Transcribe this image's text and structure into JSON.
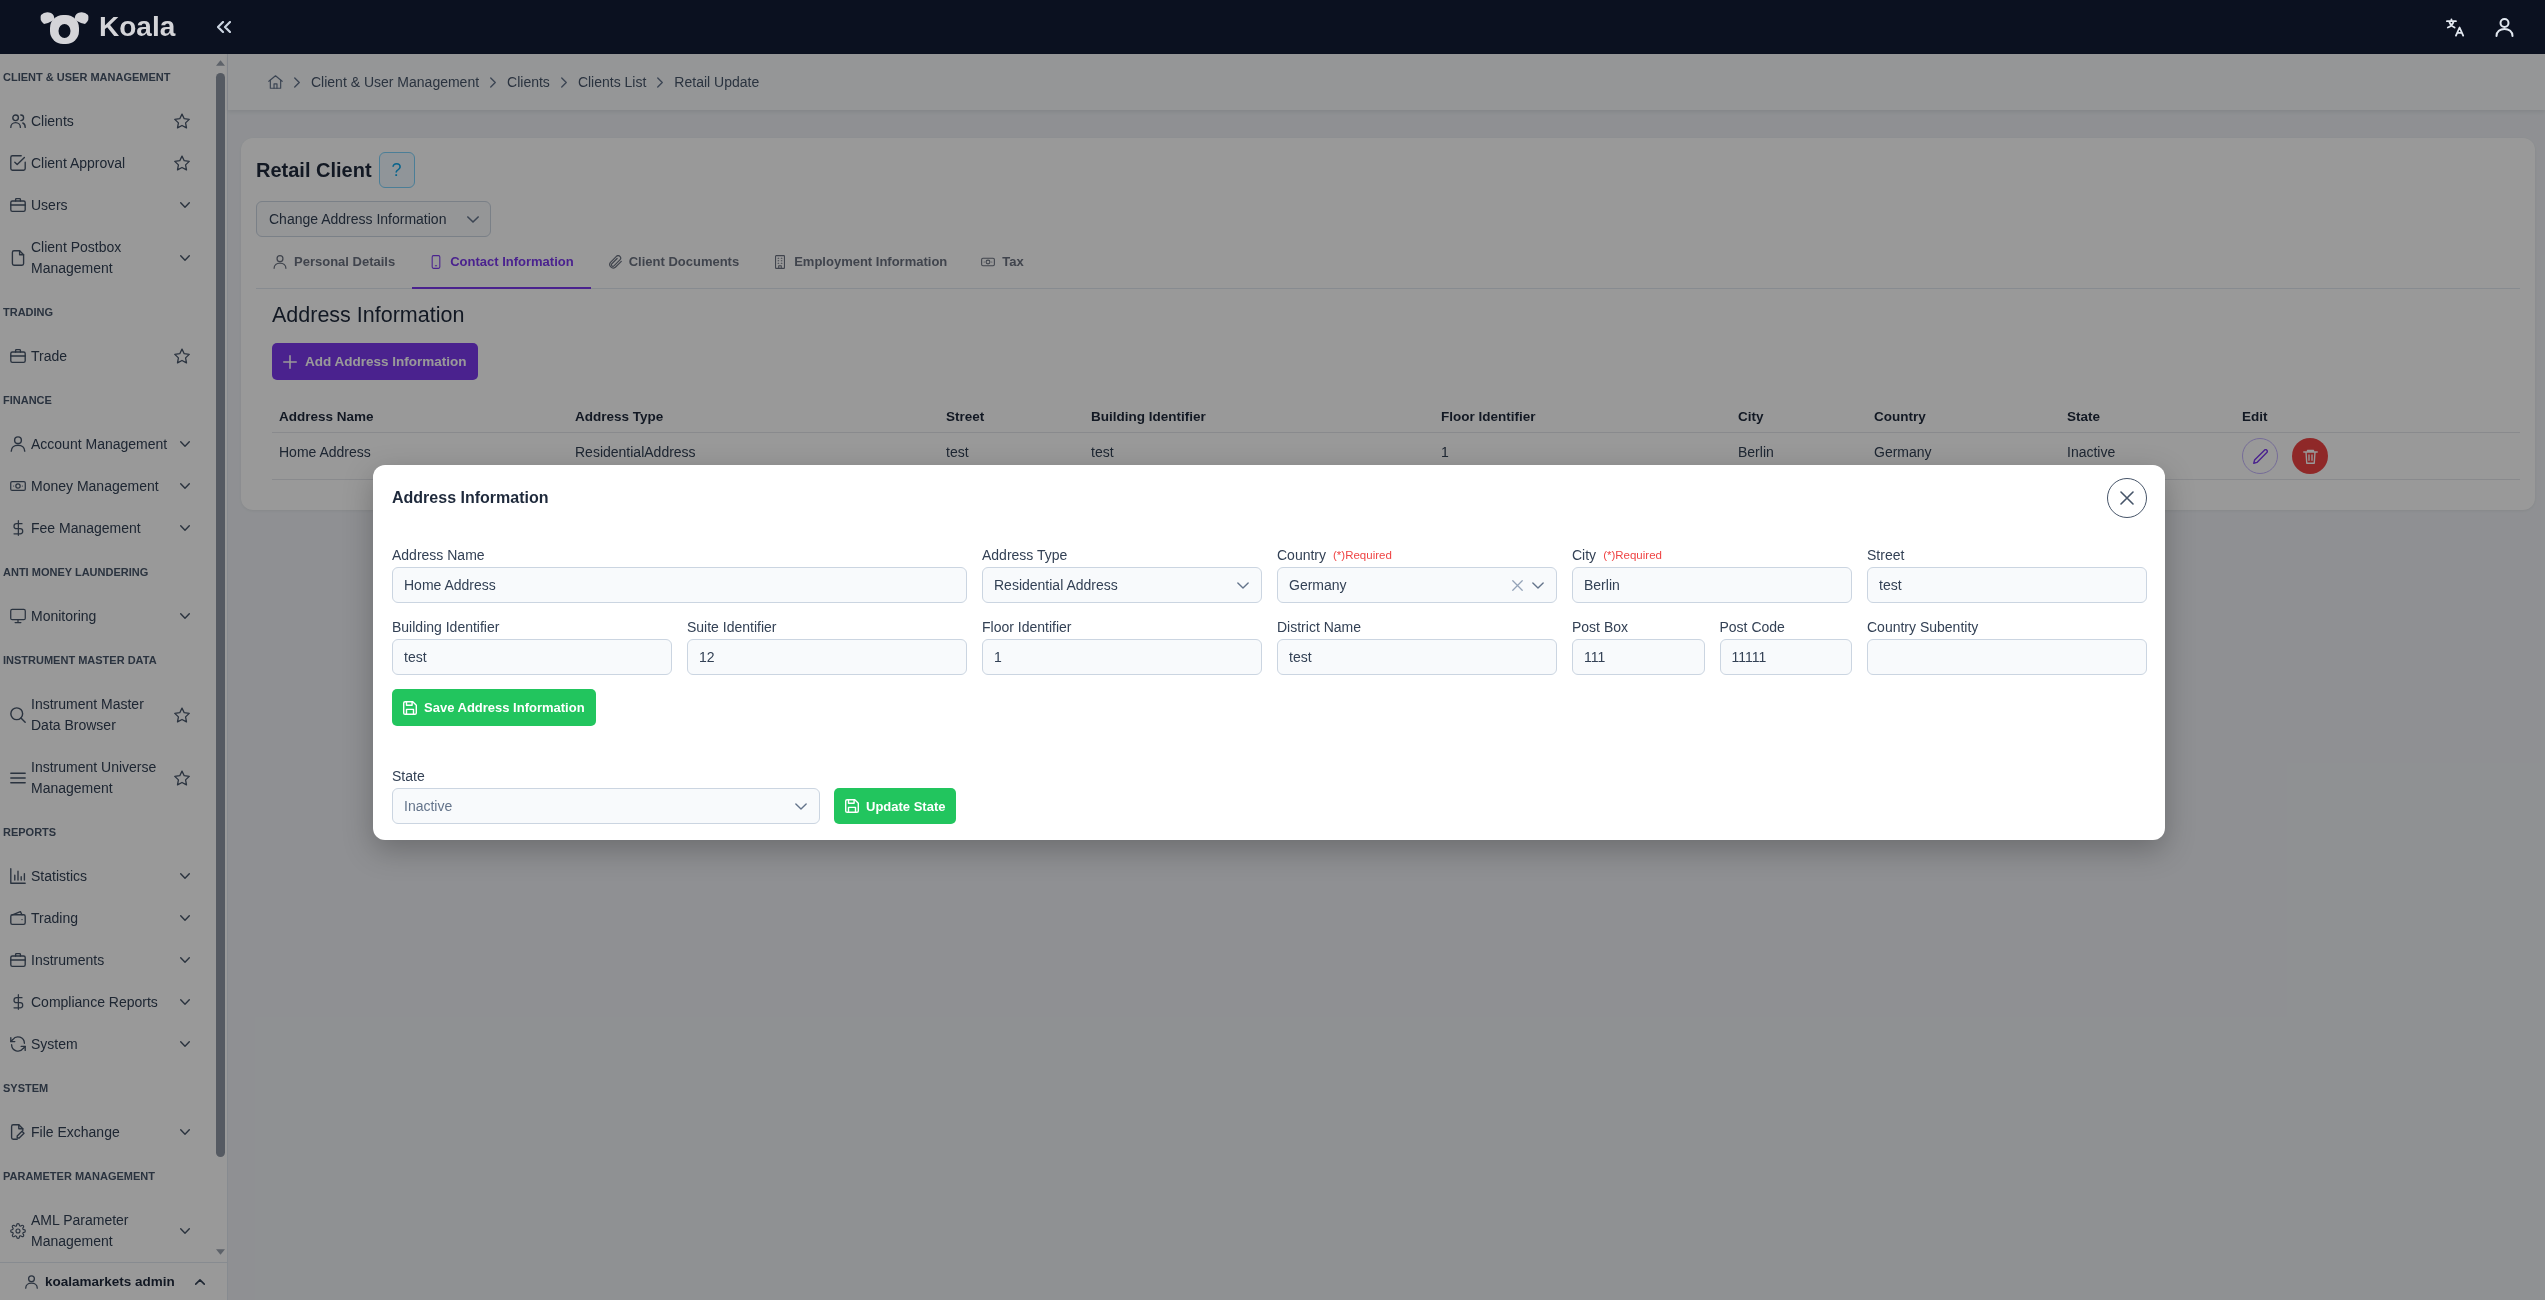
{
  "topbar": {
    "logo_text": "Koala"
  },
  "sidebar": {
    "sections": [
      {
        "title": "CLIENT & USER MANAGEMENT",
        "items": [
          {
            "label": "Clients",
            "kind": "favorite"
          },
          {
            "label": "Client Approval",
            "kind": "favorite"
          },
          {
            "label": "Users",
            "kind": "expandable"
          },
          {
            "label": "Client Postbox Management",
            "kind": "expandable"
          }
        ]
      },
      {
        "title": "TRADING",
        "items": [
          {
            "label": "Trade",
            "kind": "favorite"
          }
        ]
      },
      {
        "title": "FINANCE",
        "items": [
          {
            "label": "Account Management",
            "kind": "expandable"
          },
          {
            "label": "Money Management",
            "kind": "expandable"
          },
          {
            "label": "Fee Management",
            "kind": "expandable"
          }
        ]
      },
      {
        "title": "ANTI MONEY LAUNDERING",
        "items": [
          {
            "label": "Monitoring",
            "kind": "expandable"
          }
        ]
      },
      {
        "title": "INSTRUMENT MASTER DATA",
        "items": [
          {
            "label": "Instrument Master Data Browser",
            "kind": "favorite"
          },
          {
            "label": "Instrument Universe Management",
            "kind": "favorite"
          }
        ]
      },
      {
        "title": "REPORTS",
        "items": [
          {
            "label": "Statistics",
            "kind": "expandable"
          },
          {
            "label": "Trading",
            "kind": "expandable"
          },
          {
            "label": "Instruments",
            "kind": "expandable"
          },
          {
            "label": "Compliance Reports",
            "kind": "expandable"
          },
          {
            "label": "System",
            "kind": "expandable"
          }
        ]
      },
      {
        "title": "SYSTEM",
        "items": [
          {
            "label": "File Exchange",
            "kind": "expandable"
          }
        ]
      },
      {
        "title": "PARAMETER MANAGEMENT",
        "items": [
          {
            "label": "AML Parameter Management",
            "kind": "expandable"
          }
        ]
      }
    ],
    "user_name": "koalamarkets admin"
  },
  "breadcrumb": [
    "Client & User Management",
    "Clients",
    "Clients List",
    "Retail Update"
  ],
  "page": {
    "title": "Retail Client",
    "help_button": "?",
    "action_select": "Change Address Information",
    "tabs": [
      {
        "label": "Personal Details",
        "selected": false
      },
      {
        "label": "Contact Information",
        "selected": true
      },
      {
        "label": "Client Documents",
        "selected": false
      },
      {
        "label": "Employment Information",
        "selected": false
      },
      {
        "label": "Tax",
        "selected": false
      }
    ],
    "section_title": "Address Information",
    "add_button": "Add Address Information",
    "table": {
      "columns": [
        "Address Name",
        "Address Type",
        "Street",
        "Building Identifier",
        "Floor Identifier",
        "City",
        "Country",
        "State",
        "Edit"
      ],
      "rows": [
        {
          "cells": [
            "Home Address",
            "ResidentialAddress",
            "test",
            "test",
            "1",
            "Berlin",
            "Germany",
            "Inactive"
          ]
        }
      ]
    }
  },
  "modal": {
    "title": "Address Information",
    "fields": [
      {
        "label": "Address Name",
        "kind": "text",
        "value": "Home Address"
      },
      {
        "label": "Address Type",
        "kind": "select",
        "value": "Residential Address"
      },
      {
        "label": "Country",
        "required_note": "(*)Required",
        "kind": "clearable-select",
        "value": "Germany"
      },
      {
        "label": "City",
        "required_note": "(*)Required",
        "kind": "text",
        "value": "Berlin"
      },
      {
        "label": "Street",
        "kind": "text",
        "value": "test"
      },
      {
        "label": "Building Identifier",
        "kind": "text",
        "value": "test"
      },
      {
        "label": "Suite Identifier",
        "kind": "text",
        "value": "12"
      },
      {
        "label": "Floor Identifier",
        "kind": "text",
        "value": "1"
      },
      {
        "label": "District Name",
        "kind": "text",
        "value": "test"
      },
      {
        "label": "Post Box",
        "kind": "text",
        "value": "111"
      },
      {
        "label": "Post Code",
        "kind": "text",
        "value": "11111"
      },
      {
        "label": "Country Subentity",
        "kind": "text"
      }
    ],
    "save_button": "Save Address Information",
    "state_field": {
      "label": "State",
      "value": "Inactive"
    },
    "update_button": "Update State"
  }
}
